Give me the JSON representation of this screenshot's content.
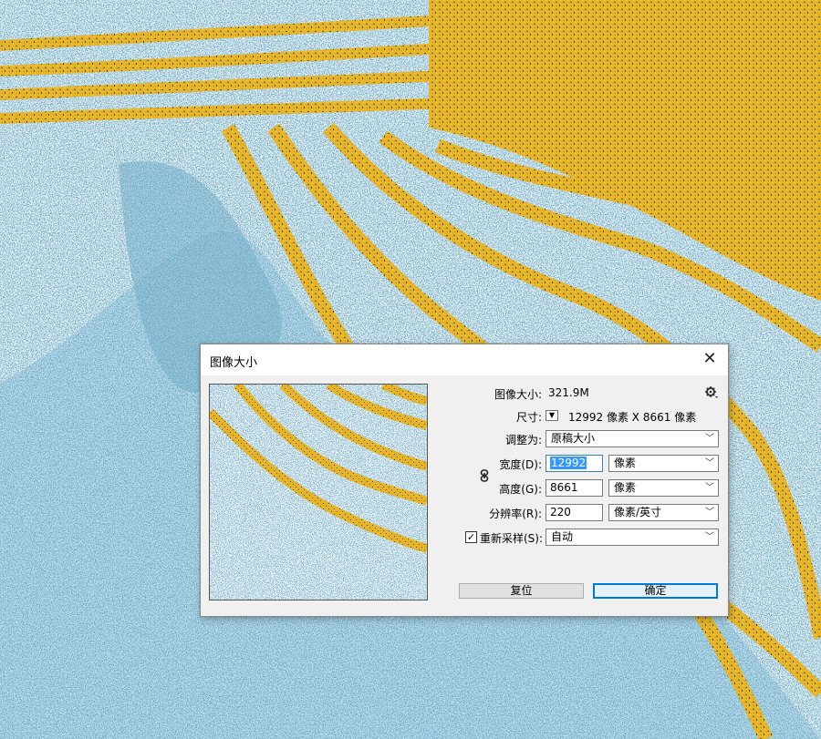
{
  "dialog": {
    "title": "图像大小",
    "close_symbol": "✕",
    "image_size_label": "图像大小:",
    "image_size_value": "321.9M",
    "dimensions_label": "尺寸:",
    "dimensions_value": "12992 像素  X  8661 像素",
    "fit_to_label": "调整为:",
    "fit_to_value": "原稿大小",
    "width_label": "宽度(D):",
    "width_value": "12992",
    "width_unit": "像素",
    "height_label": "高度(G):",
    "height_value": "8661",
    "height_unit": "像素",
    "resolution_label": "分辨率(R):",
    "resolution_value": "220",
    "resolution_unit": "像素/英寸",
    "resample_label": "重新采样(S):",
    "resample_checked": true,
    "resample_value": "自动",
    "reset_label": "复位",
    "ok_label": "确定"
  },
  "icons": {
    "close": "close-icon",
    "settings": "gear-icon",
    "dropdown": "chevron-down-icon",
    "constrain": "link-icon",
    "checkbox": "checkmark-icon"
  },
  "colors": {
    "gold": "#e8b423",
    "blue": "#2f6b8c",
    "light_blue": "#a9d8ea",
    "dialog_bg": "#f0f0f0",
    "accent": "#0078d7"
  }
}
